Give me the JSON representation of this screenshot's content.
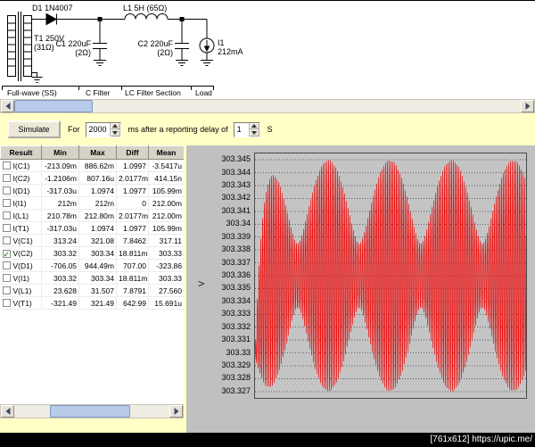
{
  "schematic": {
    "d1": "D1 1N4007",
    "t1_line1": "T1 250V",
    "t1_line2": "(31Ω)",
    "c1_line1": "C1 220uF",
    "c1_line2": "(2Ω)",
    "l1": "L1 5H (65Ω)",
    "c2_line1": "C2 220uF",
    "c2_line2": "(2Ω)",
    "i1_line1": "I1",
    "i1_line2": "212mA",
    "sections": [
      "Full-wave (SS)",
      "C Filter",
      "LC Filter Section",
      "Load"
    ]
  },
  "controls": {
    "simulate": "Simulate",
    "for_label": "For",
    "duration_value": "2000",
    "mid_label": "ms  after a reporting delay of",
    "delay_value": "1",
    "s_label": "S"
  },
  "results": {
    "check_glyph": "✓",
    "columns": [
      "Result",
      "Min",
      "Max",
      "Diff",
      "Mean"
    ],
    "rows": [
      {
        "name": "I(C1)",
        "checked": false,
        "min": "-213.09m",
        "max": "886.62m",
        "diff": "1.0997",
        "mean": "-3.5417u"
      },
      {
        "name": "I(C2)",
        "checked": false,
        "min": "-1.2106m",
        "max": "807.16u",
        "diff": "2.0177m",
        "mean": "414.15n"
      },
      {
        "name": "I(D1)",
        "checked": false,
        "min": "-317.03u",
        "max": "1.0974",
        "diff": "1.0977",
        "mean": "105.99m"
      },
      {
        "name": "I(I1)",
        "checked": false,
        "min": "212m",
        "max": "212m",
        "diff": "0",
        "mean": "212.00m"
      },
      {
        "name": "I(L1)",
        "checked": false,
        "min": "210.78m",
        "max": "212.80m",
        "diff": "2.0177m",
        "mean": "212.00m"
      },
      {
        "name": "I(T1)",
        "checked": false,
        "min": "-317.03u",
        "max": "1.0974",
        "diff": "1.0977",
        "mean": "105.99m"
      },
      {
        "name": "V(C1)",
        "checked": false,
        "min": "313.24",
        "max": "321.08",
        "diff": "7.8462",
        "mean": "317.11"
      },
      {
        "name": "V(C2)",
        "checked": true,
        "min": "303.32",
        "max": "303.34",
        "diff": "18.811m",
        "mean": "303.33"
      },
      {
        "name": "V(D1)",
        "checked": false,
        "min": "-706.05",
        "max": "944.49m",
        "diff": "707.00",
        "mean": "-323.86"
      },
      {
        "name": "V(I1)",
        "checked": false,
        "min": "303.32",
        "max": "303.34",
        "diff": "18.811m",
        "mean": "303.33"
      },
      {
        "name": "V(L1)",
        "checked": false,
        "min": "23.628",
        "max": "31.507",
        "diff": "7.8791",
        "mean": "27.560"
      },
      {
        "name": "V(T1)",
        "checked": false,
        "min": "-321.49",
        "max": "321.49",
        "diff": "642.99",
        "mean": "15.691u"
      }
    ]
  },
  "chart_data": {
    "type": "line",
    "series": "V(C2)",
    "ylabel": "V",
    "line_color": "#ef0808",
    "grid": true,
    "y_min": 303.3265,
    "y_max": 303.3455,
    "y_ticks": [
      "303.345",
      "303.344",
      "303.343",
      "303.342",
      "303.341",
      "303.34",
      "303.339",
      "303.338",
      "303.337",
      "303.336",
      "303.335",
      "303.334",
      "303.333",
      "303.332",
      "303.331",
      "303.33",
      "303.329",
      "303.328",
      "303.327"
    ],
    "waveform": {
      "description": "dense ripple voltage on C2 with beating envelope between 303.327 and 303.345 V",
      "center": 303.336,
      "center_dip": 0.0065,
      "ramp": 45,
      "a1": 0.00575,
      "a2": 0.00325,
      "f1": 152,
      "f2": 156.4,
      "phase2": -1.2
    }
  },
  "watermark": "[761x612] https://upic.me/"
}
